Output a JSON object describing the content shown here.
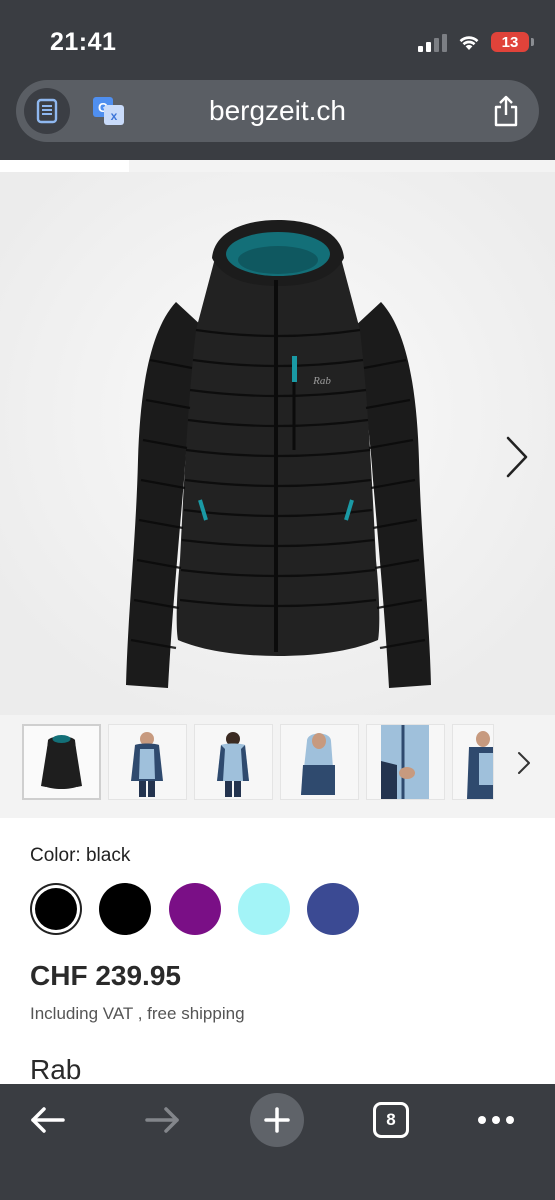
{
  "status_bar": {
    "time": "21:41",
    "battery_level": "13",
    "icons": [
      "cellular-signal-icon",
      "wifi-icon",
      "battery-icon"
    ]
  },
  "browser": {
    "url": "bergzeit.ch",
    "buttons": [
      "reader-mode-icon",
      "translate-icon",
      "share-icon"
    ]
  },
  "gallery": {
    "main_image": "black Rab hooded down jacket",
    "jacket_logo": "Rab",
    "thumbnail_count": 6,
    "selected_thumbnail": 0
  },
  "product": {
    "color_label": "Color: black",
    "swatches": [
      {
        "name": "black",
        "color": "#000000",
        "selected": true
      },
      {
        "name": "black",
        "color": "#000000",
        "selected": false
      },
      {
        "name": "purple",
        "color": "#7a0f86",
        "selected": false
      },
      {
        "name": "light-blue",
        "color": "#a3f4f7",
        "selected": false
      },
      {
        "name": "navy-blue",
        "color": "#3b4a93",
        "selected": false
      }
    ],
    "price": "CHF 239.95",
    "price_note": "Including VAT  , free shipping",
    "brand": "Rab"
  },
  "toolbar": {
    "tab_count": "8",
    "buttons": [
      "back-arrow-icon",
      "forward-arrow-icon",
      "new-tab-icon",
      "tabs-icon",
      "more-icon"
    ]
  },
  "colors": {
    "chrome_bg": "#3a3d42",
    "url_bar_bg": "#5a5e64",
    "gallery_bg": "#f3f3f3",
    "battery_red": "#e0433a"
  }
}
